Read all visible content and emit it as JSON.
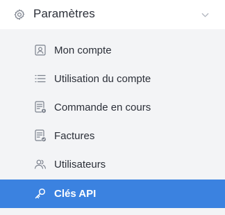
{
  "header": {
    "title": "Paramètres",
    "icon": "gear-icon",
    "toggle_icon": "chevron-down-icon"
  },
  "submenu": {
    "items": [
      {
        "label": "Mon compte",
        "icon": "account-card-icon",
        "active": false
      },
      {
        "label": "Utilisation du compte",
        "icon": "list-icon",
        "active": false
      },
      {
        "label": "Commande en cours",
        "icon": "pending-order-icon",
        "active": false
      },
      {
        "label": "Factures",
        "icon": "invoice-check-icon",
        "active": false
      },
      {
        "label": "Utilisateurs",
        "icon": "users-icon",
        "active": false
      },
      {
        "label": "Clés API",
        "icon": "key-icon",
        "active": true
      }
    ]
  },
  "colors": {
    "active_background": "#3b82e0",
    "submenu_background": "#f3f4f6",
    "text": "#2b2f38",
    "icon": "#7a808c"
  }
}
